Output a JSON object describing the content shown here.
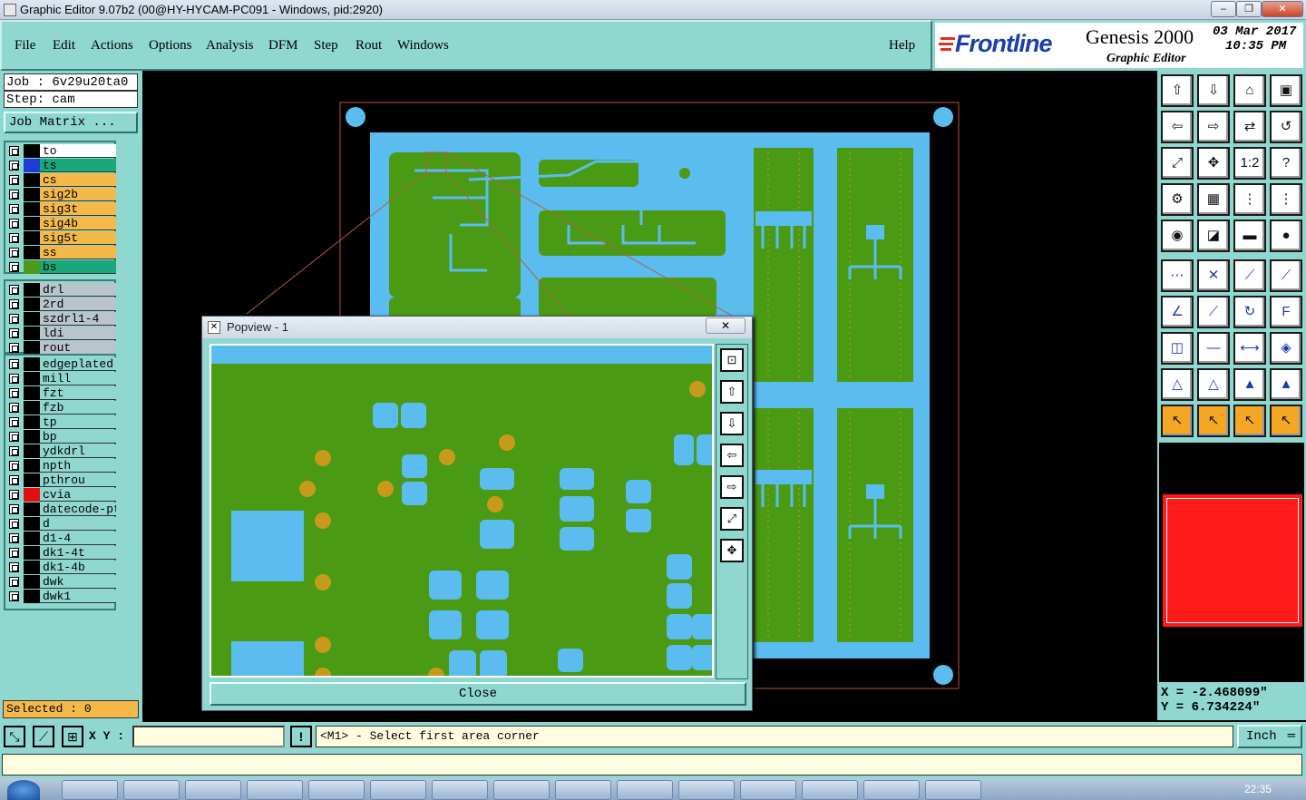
{
  "window": {
    "title": "Graphic Editor 9.07b2 (00@HY-HYCAM-PC091 - Windows, pid:2920)",
    "controls": [
      "minimize-icon",
      "maximize-icon",
      "close-icon"
    ]
  },
  "menu": {
    "items": [
      "File",
      "Edit",
      "Actions",
      "Options",
      "Analysis",
      "DFM",
      "Step",
      "Rout",
      "Windows"
    ],
    "help": "Help"
  },
  "brand": {
    "logo": "Frontline",
    "product": "Genesis 2000",
    "subtitle": "Graphic Editor",
    "date": "03 Mar 2017",
    "time": "10:35 PM"
  },
  "job": {
    "job_label": "Job : 6v29u20ta0",
    "step_label": "Step: cam",
    "matrix_button": "Job Matrix ..."
  },
  "layers": {
    "board": [
      {
        "name": "to",
        "color": "#ffffff",
        "swatch": "#000000"
      },
      {
        "name": "ts",
        "color": "#1aa77b",
        "swatch": "#1f3bd6"
      },
      {
        "name": "cs",
        "color": "#f5b94a",
        "swatch": "#000000"
      },
      {
        "name": "sig2b",
        "color": "#f5b94a",
        "swatch": "#000000"
      },
      {
        "name": "sig3t",
        "color": "#f5b94a",
        "swatch": "#000000"
      },
      {
        "name": "sig4b",
        "color": "#f5b94a",
        "swatch": "#000000"
      },
      {
        "name": "sig5t",
        "color": "#f5b94a",
        "swatch": "#000000"
      },
      {
        "name": "ss",
        "color": "#f5b94a",
        "swatch": "#000000"
      },
      {
        "name": "bs",
        "color": "#1aa77b",
        "swatch": "#4c9a1a"
      }
    ],
    "drill": [
      {
        "name": "drl",
        "color": "#b9c4cc",
        "swatch": "#000000"
      },
      {
        "name": "2rd",
        "color": "#b9c4cc",
        "swatch": "#000000"
      },
      {
        "name": "szdrl1-4",
        "color": "#b9c4cc",
        "swatch": "#000000"
      },
      {
        "name": "ldi",
        "color": "#b9c4cc",
        "swatch": "#000000"
      },
      {
        "name": "rout",
        "color": "#b9c4cc",
        "swatch": "#000000"
      }
    ],
    "misc": [
      {
        "name": "edgeplated",
        "color": "#8fd7cf",
        "swatch": "#000000"
      },
      {
        "name": "mill",
        "color": "#8fd7cf",
        "swatch": "#000000"
      },
      {
        "name": "fzt",
        "color": "#8fd7cf",
        "swatch": "#000000"
      },
      {
        "name": "fzb",
        "color": "#8fd7cf",
        "swatch": "#000000"
      },
      {
        "name": "tp",
        "color": "#8fd7cf",
        "swatch": "#000000"
      },
      {
        "name": "bp",
        "color": "#8fd7cf",
        "swatch": "#000000"
      },
      {
        "name": "ydkdrl",
        "color": "#8fd7cf",
        "swatch": "#000000"
      },
      {
        "name": "npth",
        "color": "#8fd7cf",
        "swatch": "#000000"
      },
      {
        "name": "pthrou",
        "color": "#8fd7cf",
        "swatch": "#000000"
      },
      {
        "name": "cvia",
        "color": "#8fd7cf",
        "swatch": "#e01010"
      },
      {
        "name": "datecode-pt",
        "color": "#8fd7cf",
        "swatch": "#000000"
      },
      {
        "name": "d",
        "color": "#8fd7cf",
        "swatch": "#000000"
      },
      {
        "name": "d1-4",
        "color": "#8fd7cf",
        "swatch": "#000000"
      },
      {
        "name": "dk1-4t",
        "color": "#8fd7cf",
        "swatch": "#000000"
      },
      {
        "name": "dk1-4b",
        "color": "#8fd7cf",
        "swatch": "#000000"
      },
      {
        "name": "dwk",
        "color": "#8fd7cf",
        "swatch": "#000000"
      },
      {
        "name": "dwk1",
        "color": "#8fd7cf",
        "swatch": "#000000"
      }
    ]
  },
  "selected": "Selected : 0",
  "popview": {
    "title": "Popview - 1",
    "close_button": "Close"
  },
  "coords": {
    "x": "X = -2.468099\"",
    "y": "Y = 6.734224\""
  },
  "status": {
    "xy_label": "X Y :",
    "xy_value": "",
    "message": "<M1> - Select first area corner",
    "units": "Inch"
  },
  "taskbar": {
    "time": "22:35"
  },
  "colors": {
    "panel": "#8fd7cf",
    "board_copper": "#4a9a14",
    "pad": "#5bbcf0",
    "via": "#c89a1a",
    "selection": "#ff1a1a"
  }
}
